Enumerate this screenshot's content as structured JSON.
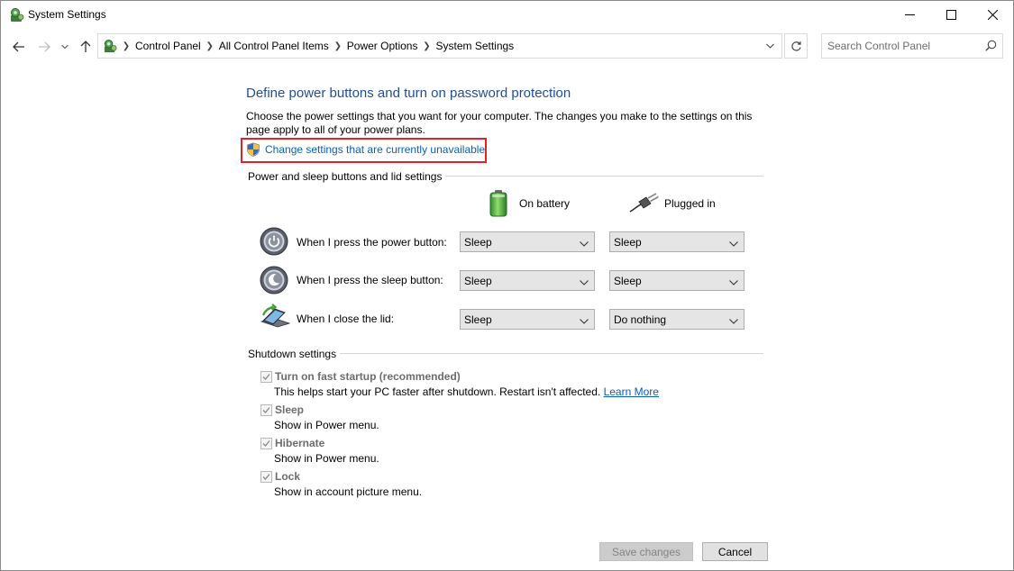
{
  "window": {
    "title": "System Settings"
  },
  "colors": {
    "heading": "#1e4e9a",
    "link": "#0a5fb5",
    "highlight_box": "#e0222a"
  },
  "icons": {
    "title": "control-panel-icon",
    "back": "back-arrow-icon",
    "forward": "forward-arrow-icon",
    "recent": "chevron-down-icon",
    "up": "up-arrow-icon",
    "address": "control-panel-icon",
    "refresh": "refresh-icon",
    "search": "search-icon",
    "uac": "uac-shield-icon",
    "battery": "battery-icon",
    "plugged": "power-plug-icon",
    "power_button": "power-button-icon",
    "sleep_button": "sleep-button-icon",
    "lid": "laptop-lid-icon"
  },
  "breadcrumb": [
    "Control Panel",
    "All Control Panel Items",
    "Power Options",
    "System Settings"
  ],
  "search": {
    "placeholder": "Search Control Panel"
  },
  "main": {
    "heading": "Define power buttons and turn on password protection",
    "description": "Choose the power settings that you want for your computer. The changes you make to the settings on this page apply to all of your power plans.",
    "change_link": "Change settings that are currently unavailable",
    "buttons_section": {
      "title": "Power and sleep buttons and lid settings",
      "columns": [
        "On battery",
        "Plugged in"
      ],
      "rows": [
        {
          "label": "When I press the power button:",
          "on_battery": "Sleep",
          "plugged_in": "Sleep"
        },
        {
          "label": "When I press the sleep button:",
          "on_battery": "Sleep",
          "plugged_in": "Sleep"
        },
        {
          "label": "When I close the lid:",
          "on_battery": "Sleep",
          "plugged_in": "Do nothing"
        }
      ]
    },
    "shutdown_section": {
      "title": "Shutdown settings",
      "items": [
        {
          "label": "Turn on fast startup (recommended)",
          "description": "This helps start your PC faster after shutdown. Restart isn't affected.",
          "link": "Learn More",
          "checked": true
        },
        {
          "label": "Sleep",
          "description": "Show in Power menu.",
          "checked": true
        },
        {
          "label": "Hibernate",
          "description": "Show in Power menu.",
          "checked": true
        },
        {
          "label": "Lock",
          "description": "Show in account picture menu.",
          "checked": true
        }
      ]
    }
  },
  "footer": {
    "save_label": "Save changes",
    "cancel_label": "Cancel"
  }
}
